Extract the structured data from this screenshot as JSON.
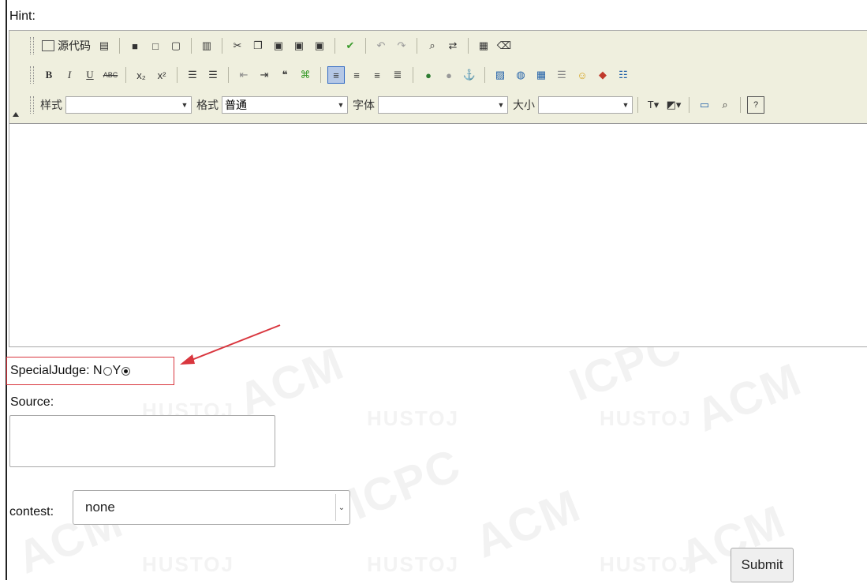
{
  "form": {
    "hint_label": "Hint:",
    "special_judge_label": "SpecialJudge: N",
    "special_judge_y": "Y",
    "special_judge_value": "Y",
    "source_label": "Source:",
    "contest_label": "contest:",
    "contest_selected": "none",
    "submit_label": "Submit"
  },
  "editor": {
    "source_button": "源代码",
    "style_label": "样式",
    "style_value": "",
    "format_label": "格式",
    "format_value": "普通",
    "font_label": "字体",
    "font_value": "",
    "size_label": "大小",
    "size_value": "",
    "row1_icons": [
      "document-icon",
      "copy-template-icon",
      "save-icon",
      "new-page-icon",
      "preview-icon",
      "templates-icon",
      "cut-icon",
      "copy-icon",
      "paste-icon",
      "paste-text-icon",
      "paste-word-icon",
      "spellcheck-icon",
      "undo-icon",
      "redo-icon",
      "find-icon",
      "replace-icon",
      "select-all-icon",
      "remove-format-icon"
    ],
    "row2_icons": [
      "bold-icon",
      "italic-icon",
      "underline-icon",
      "strike-icon",
      "subscript-icon",
      "superscript-icon",
      "ordered-list-icon",
      "unordered-list-icon",
      "outdent-icon",
      "indent-icon",
      "blockquote-icon",
      "div-icon",
      "align-left-icon",
      "align-center-icon",
      "align-right-icon",
      "justify-icon",
      "link-icon",
      "unlink-icon",
      "anchor-icon",
      "image-icon",
      "flash-icon",
      "table-icon",
      "horizontal-rule-icon",
      "smiley-icon",
      "special-char-icon",
      "page-break-icon"
    ],
    "row3_icons": [
      "text-color-icon",
      "bg-color-icon",
      "maximize-icon",
      "show-blocks-icon",
      "help-icon"
    ]
  },
  "watermark": {
    "big": "ACM ICPC",
    "small": "HUSTOJ"
  },
  "colors": {
    "toolbar_bg": "#efefde",
    "annotation_red": "#d9363e",
    "active_button": "#b5c8e6"
  }
}
